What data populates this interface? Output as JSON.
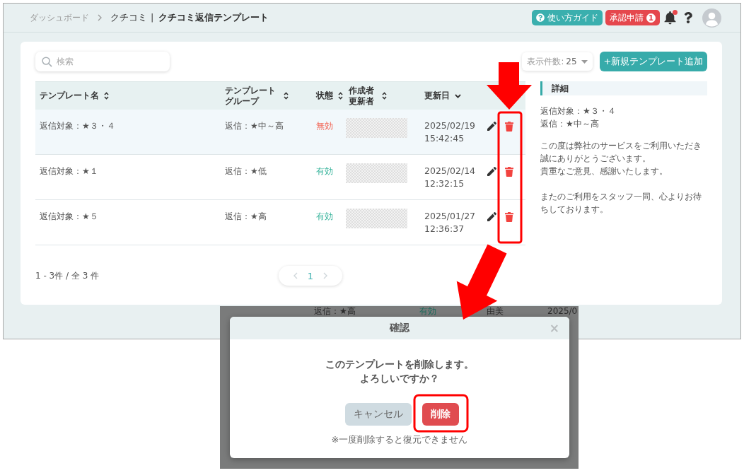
{
  "header": {
    "breadcrumbs": [
      {
        "label": "ダッシュボード"
      },
      {
        "label": "クチコミ"
      }
    ],
    "separator": "|",
    "title": "クチコミ返信テンプレート",
    "guide_button": {
      "label": "使い方ガイド"
    },
    "approval_button": {
      "label": "承認申請",
      "badge": "1"
    },
    "notifications": {
      "unread": true
    }
  },
  "toolbar": {
    "search": {
      "placeholder": "検索"
    },
    "page_size": {
      "label": "表示件数:",
      "value": "25"
    },
    "add_button": {
      "label": "+新規テンプレート追加"
    }
  },
  "table": {
    "columns": [
      {
        "label": "テンプレート名",
        "sorted": false
      },
      {
        "label": "テンプレートグループ",
        "sorted": false
      },
      {
        "label": "状態",
        "sorted": false
      },
      {
        "label": "作成者更新者",
        "sorted": false
      },
      {
        "label": "更新日",
        "sorted": true
      }
    ],
    "rows": [
      {
        "name": "返信対象：★３・４",
        "group": "返信：★中～高",
        "status": {
          "label": "無効",
          "enabled": false
        },
        "updated": "2025/02/19 15:42:45",
        "selected": true
      },
      {
        "name": "返信対象：★１",
        "group": "返信：★低",
        "status": {
          "label": "有効",
          "enabled": true
        },
        "updated": "2025/02/14 12:32:15",
        "selected": false
      },
      {
        "name": "返信対象：★５",
        "group": "返信：★高",
        "status": {
          "label": "有効",
          "enabled": true
        },
        "updated": "2025/01/27 12:36:37",
        "selected": false
      }
    ]
  },
  "detail": {
    "title": "詳細",
    "summary": [
      "返信対象：★３・４",
      "返信：★中～高"
    ],
    "paragraphs": [
      {
        "lines": [
          "この度は弊社のサービスをご利用いただき誠にありがとうございます。",
          "貴重なご意見、感謝いたします。"
        ]
      },
      {
        "lines": [
          "またのご利用をスタッフ一同、心よりお待ちしております。"
        ]
      }
    ]
  },
  "pagination": {
    "summary": "1 - 3件 / 全 3 件",
    "pages": [
      {
        "label": "1",
        "selected": true
      }
    ]
  },
  "dialog_screenshot": {
    "background_row": {
      "group": "返信：★高",
      "status": {
        "label": "有効",
        "enabled": true
      },
      "name": "由美",
      "updated": "2025/0"
    },
    "dialog": {
      "title": "確認",
      "close": "×",
      "message": [
        "このテンプレートを削除します。",
        "よろしいですか？"
      ],
      "buttons": [
        {
          "label": "キャンセル",
          "kind": "cancel"
        },
        {
          "label": "削除",
          "kind": "danger"
        }
      ],
      "note": "※一度削除すると復元できません"
    }
  },
  "annotations": [
    {
      "kind": "down_arrow"
    },
    {
      "kind": "icons_frame"
    },
    {
      "kind": "diagonal_arrow"
    },
    {
      "kind": "button_frame"
    }
  ]
}
